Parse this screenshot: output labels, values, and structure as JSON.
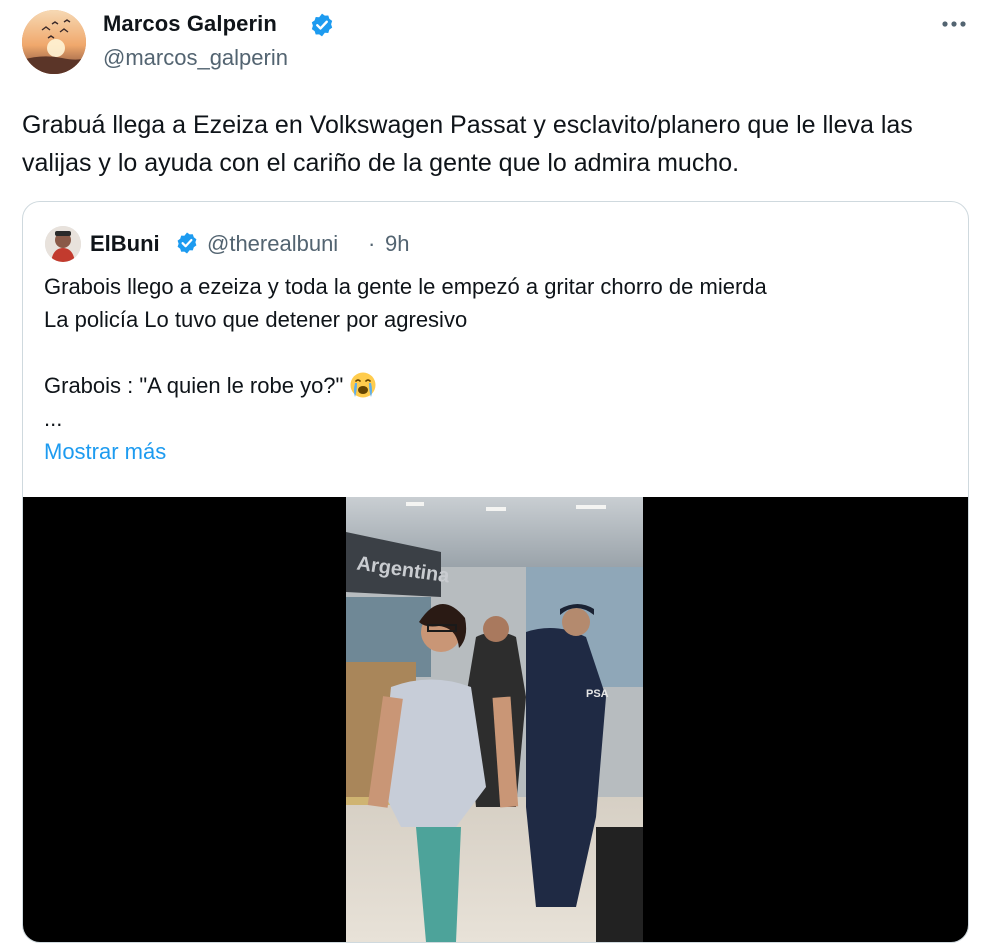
{
  "author": {
    "name": "Marcos Galperin",
    "handle": "@marcos_galperin",
    "avatar_icon": "avatar-sunset-birds",
    "verified_icon": "verified-badge-icon"
  },
  "more_icon": "more-options-icon",
  "tweet": {
    "text": "Grabuá llega a Ezeiza en Volkswagen Passat y esclavito/planero que le lleva las valijas y lo ayuda con el cariño de la gente que lo admira mucho."
  },
  "quoted": {
    "name": "ElBuni",
    "handle": "@therealbuni",
    "separator": "·",
    "time": "9h",
    "lines": [
      "Grabois llego a ezeiza y toda la gente le empezó a gritar chorro de mierda",
      "La policía Lo tuvo que detener por agresivo",
      "",
      "Grabois : \"A quien le robe yo?\"",
      "..."
    ],
    "emoji_icon": "crying-face-emoji",
    "show_more": "Mostrar más",
    "media_sign_text": "Argentina",
    "media_badge_text": "PSA"
  },
  "colors": {
    "text": "#0f1419",
    "secondary": "#536471",
    "accent": "#1d9bf0",
    "border": "#cfd9de"
  }
}
